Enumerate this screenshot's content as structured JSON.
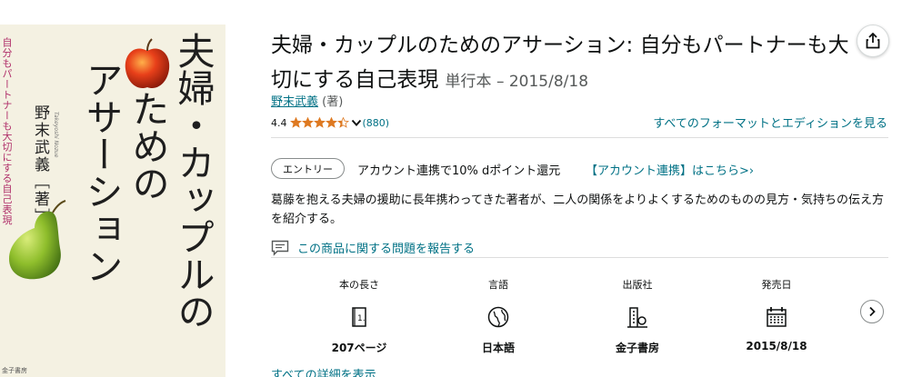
{
  "cover": {
    "title_line1": "夫婦・カップルの",
    "title_line2": "ための",
    "title_line3": "アサーション",
    "subtitle": "自分もパートナーも大切にする自己表現",
    "author": "野末武義",
    "author_role_mark": "著",
    "author_roman": "Takeyoshi Nozue",
    "publisher": "金子書房"
  },
  "product": {
    "title": "夫婦・カップルのためのアサーション: 自分もパートナーも大切にする自己表現",
    "binding": "単行本 – 2015/8/18",
    "author": "野末武義",
    "author_role": "(著)",
    "rating_value": "4.4",
    "rating_stars": 4.4,
    "review_count": "(880)",
    "formats_link": "すべてのフォーマットとエディションを見る"
  },
  "promo": {
    "badge": "エントリー",
    "text": "アカウント連携で10% dポイント還元",
    "link": "【アカウント連携】はこちら>›"
  },
  "description": "葛藤を抱える夫婦の援助に長年携わってきた著者が、二人の関係をよりよくするためのものの見方・気持ちの伝え方を紹介する。",
  "report_link": "この商品に関する問題を報告する",
  "attributes": [
    {
      "label": "本の長さ",
      "icon": "book-pages-icon",
      "value": "207ページ"
    },
    {
      "label": "言語",
      "icon": "globe-icon",
      "value": "日本語"
    },
    {
      "label": "出版社",
      "icon": "building-icon",
      "value": "金子書房"
    },
    {
      "label": "発売日",
      "icon": "calendar-icon",
      "value": "2015/8/18"
    }
  ],
  "details_link": "すべての詳細を表示",
  "colors": {
    "link": "#007185",
    "star": "#de7921",
    "text": "#0f1111",
    "muted": "#565959",
    "cover_bg": "#f4f1e2",
    "cover_subtitle": "#b0306a"
  }
}
